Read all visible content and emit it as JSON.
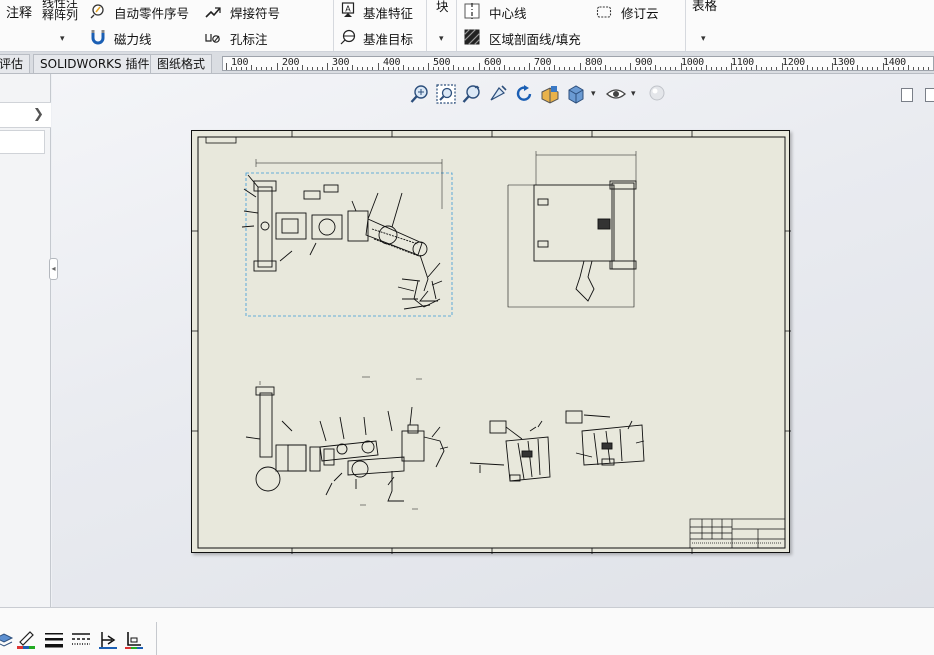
{
  "ribbon": {
    "annotation_label": "注释",
    "linear_note_line1": "线性注",
    "linear_note_line2": "释阵列",
    "auto_balloon": "自动零件序号",
    "magnetic_line": "磁力线",
    "weld_symbol": "焊接符号",
    "hole_callout": "孔标注",
    "datum_feature": "基准特征",
    "datum_target": "基准目标",
    "block_label": "块",
    "centerline": "中心线",
    "area_hatch": "区域剖面线/填充",
    "revision_cloud": "修订云",
    "tables_label": "表格"
  },
  "tabs": [
    {
      "label": "评估"
    },
    {
      "label": "SOLIDWORKS 插件"
    },
    {
      "label": "图纸格式"
    }
  ],
  "ruler": {
    "labels": [
      "100",
      "200",
      "300",
      "400",
      "500",
      "600",
      "700",
      "800",
      "900",
      "1000",
      "1100",
      "1200",
      "1300",
      "1400"
    ]
  },
  "icons": {
    "panel_chevron": "chevron-right-icon",
    "panel_grip": "collapse-grip-icon"
  },
  "hud_icons": [
    "zoom-to-fit-icon",
    "zoom-area-icon",
    "zoom-in-out-icon",
    "previous-view-icon",
    "rotate-icon",
    "section-view-icon",
    "display-style-icon",
    "hide-show-icon",
    "appearance-icon"
  ],
  "status_icons": [
    "layer-icon",
    "line-color-icon",
    "line-thickness-icon",
    "line-style-icon",
    "hide-show-edges-icon",
    "color-display-icon"
  ],
  "colors": {
    "sheet_bg": "#e8e8dc",
    "accent": "#1b5fb4",
    "selection_box": "#4a9bd8"
  }
}
